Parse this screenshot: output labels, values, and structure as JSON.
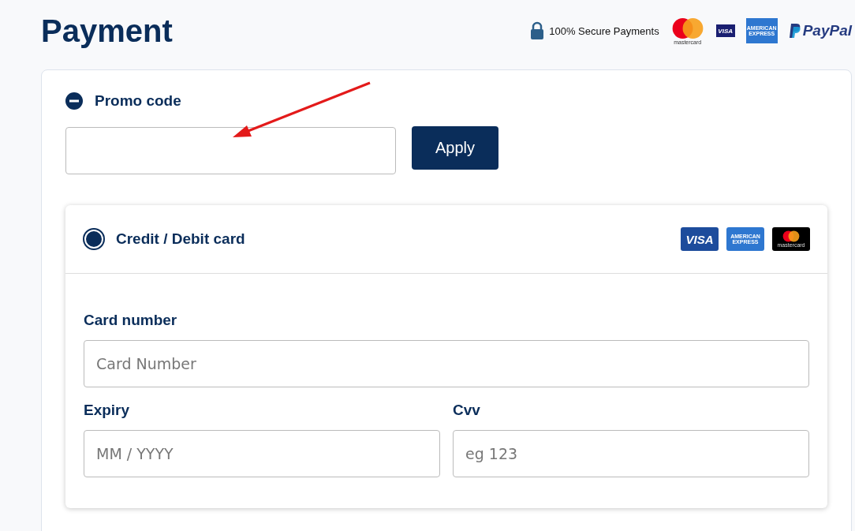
{
  "title": "Payment",
  "secure": {
    "text": "100% Secure Payments",
    "logos": [
      {
        "kind": "mastercard",
        "text": "mastercard"
      },
      {
        "kind": "visa",
        "text": "VISA"
      },
      {
        "kind": "amex",
        "text": "AMERICAN EXPRESS"
      },
      {
        "kind": "paypal",
        "text": "PayPal"
      }
    ]
  },
  "promo": {
    "label": "Promo code",
    "expanded": true,
    "button": "Apply",
    "annotation_arrow": true
  },
  "method": {
    "label": "Credit / Debit card",
    "selected": true,
    "logos": [
      {
        "kind": "visa",
        "text": "VISA"
      },
      {
        "kind": "amex",
        "text": "AMERICAN EXPRESS"
      },
      {
        "kind": "mastercard",
        "text": "mastercard"
      }
    ]
  },
  "fields": [
    {
      "label": "Card number",
      "placeholder": "Card Number",
      "kind": "wide"
    },
    {
      "label": "Expiry",
      "placeholder": "MM / YYYY"
    },
    {
      "label": "Cvv",
      "placeholder": "eg 123"
    }
  ]
}
